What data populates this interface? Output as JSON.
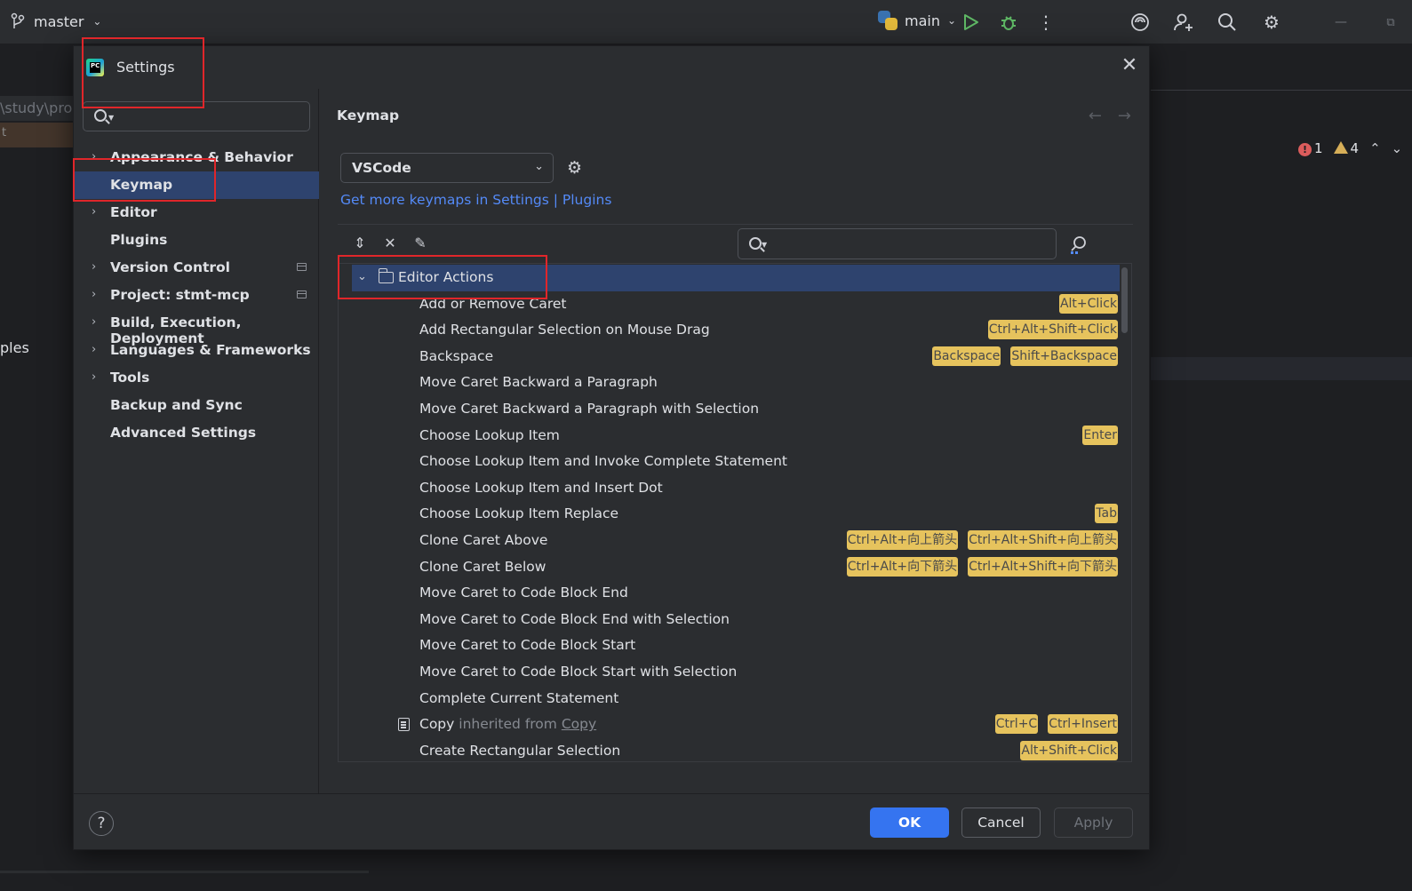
{
  "topbar": {
    "branch": "master",
    "run_config": "main",
    "icons": [
      "branch-icon",
      "python-icon",
      "run-icon",
      "debug-icon",
      "more-icon",
      "ai-assistant-icon",
      "add-user-icon",
      "search-icon",
      "gear-icon",
      "minimize-icon",
      "restore-icon"
    ]
  },
  "background": {
    "path_fragment": "\\study\\pro",
    "sel_fragment": "t",
    "left_text": "ples",
    "errors": "1",
    "warnings": "4"
  },
  "dialog": {
    "title": "Settings",
    "sidebar": {
      "items": [
        {
          "label": "Appearance & Behavior",
          "expandable": true,
          "selected": false,
          "badge": false
        },
        {
          "label": "Keymap",
          "expandable": false,
          "selected": true,
          "badge": false
        },
        {
          "label": "Editor",
          "expandable": true,
          "selected": false,
          "badge": false
        },
        {
          "label": "Plugins",
          "expandable": false,
          "selected": false,
          "badge": false
        },
        {
          "label": "Version Control",
          "expandable": true,
          "selected": false,
          "badge": true
        },
        {
          "label": "Project: stmt-mcp",
          "expandable": true,
          "selected": false,
          "badge": true
        },
        {
          "label": "Build, Execution, Deployment",
          "expandable": true,
          "selected": false,
          "badge": false
        },
        {
          "label": "Languages & Frameworks",
          "expandable": true,
          "selected": false,
          "badge": false
        },
        {
          "label": "Tools",
          "expandable": true,
          "selected": false,
          "badge": false
        },
        {
          "label": "Backup and Sync",
          "expandable": false,
          "selected": false,
          "badge": false
        },
        {
          "label": "Advanced Settings",
          "expandable": false,
          "selected": false,
          "badge": false
        }
      ]
    },
    "content": {
      "heading": "Keymap",
      "keymap_selected": "VSCode",
      "more_link": "Get more keymaps in Settings | Plugins",
      "group": "Editor Actions",
      "actions": [
        {
          "label": "Add or Remove Caret",
          "keys": [
            "Alt+Click"
          ]
        },
        {
          "label": "Add Rectangular Selection on Mouse Drag",
          "keys": [
            "Ctrl+Alt+Shift+Click"
          ]
        },
        {
          "label": "Backspace",
          "keys": [
            "Backspace",
            "Shift+Backspace"
          ]
        },
        {
          "label": "Move Caret Backward a Paragraph",
          "keys": []
        },
        {
          "label": "Move Caret Backward a Paragraph with Selection",
          "keys": []
        },
        {
          "label": "Choose Lookup Item",
          "keys": [
            "Enter"
          ]
        },
        {
          "label": "Choose Lookup Item and Invoke Complete Statement",
          "keys": []
        },
        {
          "label": "Choose Lookup Item and Insert Dot",
          "keys": []
        },
        {
          "label": "Choose Lookup Item Replace",
          "keys": [
            "Tab"
          ]
        },
        {
          "label": "Clone Caret Above",
          "keys": [
            "Ctrl+Alt+向上箭头",
            "Ctrl+Alt+Shift+向上箭头"
          ]
        },
        {
          "label": "Clone Caret Below",
          "keys": [
            "Ctrl+Alt+向下箭头",
            "Ctrl+Alt+Shift+向下箭头"
          ]
        },
        {
          "label": "Move Caret to Code Block End",
          "keys": []
        },
        {
          "label": "Move Caret to Code Block End with Selection",
          "keys": []
        },
        {
          "label": "Move Caret to Code Block Start",
          "keys": []
        },
        {
          "label": "Move Caret to Code Block Start with Selection",
          "keys": []
        },
        {
          "label": "Complete Current Statement",
          "keys": []
        },
        {
          "label": "Copy",
          "inherited_text": "inherited from",
          "inherited_link": "Copy",
          "keys": [
            "Ctrl+C",
            "Ctrl+Insert"
          ]
        },
        {
          "label": "Create Rectangular Selection",
          "keys": [
            "Alt+Shift+Click"
          ]
        }
      ]
    },
    "buttons": {
      "ok": "OK",
      "cancel": "Cancel",
      "apply": "Apply",
      "help": "?"
    }
  },
  "colors": {
    "accent": "#3574f0",
    "selection": "#2e436e",
    "shortcut_badge": "#e6c35d",
    "link": "#548af7",
    "annotation": "#e0262a"
  }
}
